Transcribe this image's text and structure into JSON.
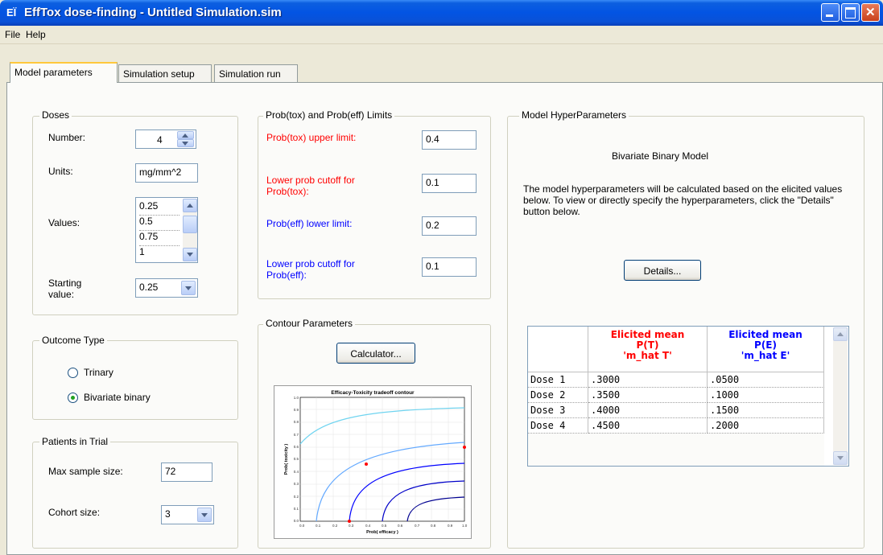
{
  "window": {
    "title": "EffTox dose-finding - Untitled Simulation.sim",
    "app_icon": "ΕΪ"
  },
  "menu": [
    "File",
    "Help"
  ],
  "tabs": [
    "Model parameters",
    "Simulation setup",
    "Simulation run"
  ],
  "active_tab": "Model parameters",
  "doses": {
    "legend": "Doses",
    "number_label": "Number:",
    "number_value": "4",
    "units_label": "Units:",
    "units_value": "mg/mm^2",
    "values_label": "Values:",
    "values_list": [
      "0.25",
      "0.5",
      "0.75",
      "1"
    ],
    "starting_label": "Starting value:",
    "starting_value": "0.25"
  },
  "outcome": {
    "legend": "Outcome Type",
    "options": [
      "Trinary",
      "Bivariate binary"
    ],
    "selected": "Bivariate binary"
  },
  "patients": {
    "legend": "Patients in Trial",
    "max_label": "Max sample size:",
    "max_value": "72",
    "cohort_label": "Cohort size:",
    "cohort_value": "3"
  },
  "limits": {
    "legend": "Prob(tox) and Prob(eff) Limits",
    "tox_upper_label": "Prob(tox) upper limit:",
    "tox_upper_value": "0.4",
    "tox_cutoff_label": "Lower prob cutoff for Prob(tox):",
    "tox_cutoff_value": "0.1",
    "eff_lower_label": "Prob(eff) lower limit:",
    "eff_lower_value": "0.2",
    "eff_cutoff_label": "Lower prob cutoff for Prob(eff):",
    "eff_cutoff_value": "0.1",
    "colors": {
      "tox": "#ff0000",
      "eff": "#0000ff"
    }
  },
  "contour": {
    "legend": "Contour Parameters",
    "calculator_label": "Calculator...",
    "plot_title": "Efficacy-Toxicity tradeoff contour",
    "xlabel": "Prob( efficacy )",
    "ylabel": "Prob( toxicity )"
  },
  "hyper": {
    "legend": "Model HyperParameters",
    "model_name": "Bivariate Binary Model",
    "description": "The model hyperparameters will be calculated based on the elicited values below.  To view or directly specify the hyperparameters, click the \"Details\" button below.",
    "details_label": "Details...",
    "grid": {
      "col_t": [
        "Elicited mean",
        "P(T)",
        "'m_hat T'"
      ],
      "col_e": [
        "Elicited mean",
        "P(E)",
        "'m_hat E'"
      ],
      "rows": [
        {
          "dose": "Dose 1",
          "t": ".3000",
          "e": ".0500"
        },
        {
          "dose": "Dose 2",
          "t": ".3500",
          "e": ".1000"
        },
        {
          "dose": "Dose 3",
          "t": ".4000",
          "e": ".1500"
        },
        {
          "dose": "Dose 4",
          "t": ".4500",
          "e": ".2000"
        }
      ]
    }
  }
}
